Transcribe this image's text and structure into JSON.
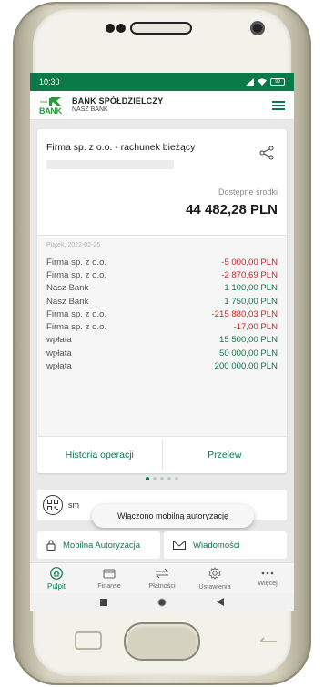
{
  "status_bar": {
    "time": "10:30",
    "battery": "99"
  },
  "bank": {
    "name_line1": "BANK SPÓŁDZIELCZY",
    "name_line2": "NASZ BANK",
    "logo_small": "nasz",
    "logo_big": "BANK"
  },
  "account": {
    "title": "Firma sp. z o.o. - rachunek bieżący",
    "available_label": "Dostępne środki",
    "available_amount": "44 482,28 PLN"
  },
  "transactions": {
    "date": "Piątek, 2022-02-25",
    "items": [
      {
        "desc": "Firma sp. z o.o.",
        "amount": "-5 000,00 PLN",
        "sign": "neg"
      },
      {
        "desc": "Firma sp. z o.o.",
        "amount": "-2 870,69 PLN",
        "sign": "neg"
      },
      {
        "desc": "Nasz Bank",
        "amount": "1 100,00 PLN",
        "sign": "pos"
      },
      {
        "desc": "Nasz Bank",
        "amount": "1 750,00 PLN",
        "sign": "pos"
      },
      {
        "desc": "Firma sp. z o.o.",
        "amount": "-215 880,03 PLN",
        "sign": "neg"
      },
      {
        "desc": "Firma sp. z o.o.",
        "amount": "-17,00 PLN",
        "sign": "neg"
      },
      {
        "desc": "wpłata",
        "amount": "15 500,00 PLN",
        "sign": "pos"
      },
      {
        "desc": "wpłata",
        "amount": "50 000,00 PLN",
        "sign": "pos"
      },
      {
        "desc": "wpłata",
        "amount": "200 000,00 PLN",
        "sign": "pos"
      }
    ]
  },
  "card_actions": {
    "history": "Historia operacji",
    "transfer": "Przelew"
  },
  "pager": {
    "count": 5,
    "active": 0
  },
  "qr": {
    "label": "sm"
  },
  "toast": {
    "message": "Włączono mobilną autoryzację"
  },
  "tiles": {
    "mobile_auth": "Mobilna Autoryzacja",
    "messages": "Wiadomości"
  },
  "nav": {
    "items": [
      {
        "label": "Pulpit",
        "icon": "home-icon"
      },
      {
        "label": "Finanse",
        "icon": "wallet-icon"
      },
      {
        "label": "Płatności",
        "icon": "transfer-arrows-icon"
      },
      {
        "label": "Ustawienia",
        "icon": "gear-icon"
      },
      {
        "label": "Więcej",
        "icon": "more-dots-icon"
      }
    ],
    "active": 0
  },
  "colors": {
    "brand": "#0b7a49",
    "negative": "#e11b1b"
  }
}
